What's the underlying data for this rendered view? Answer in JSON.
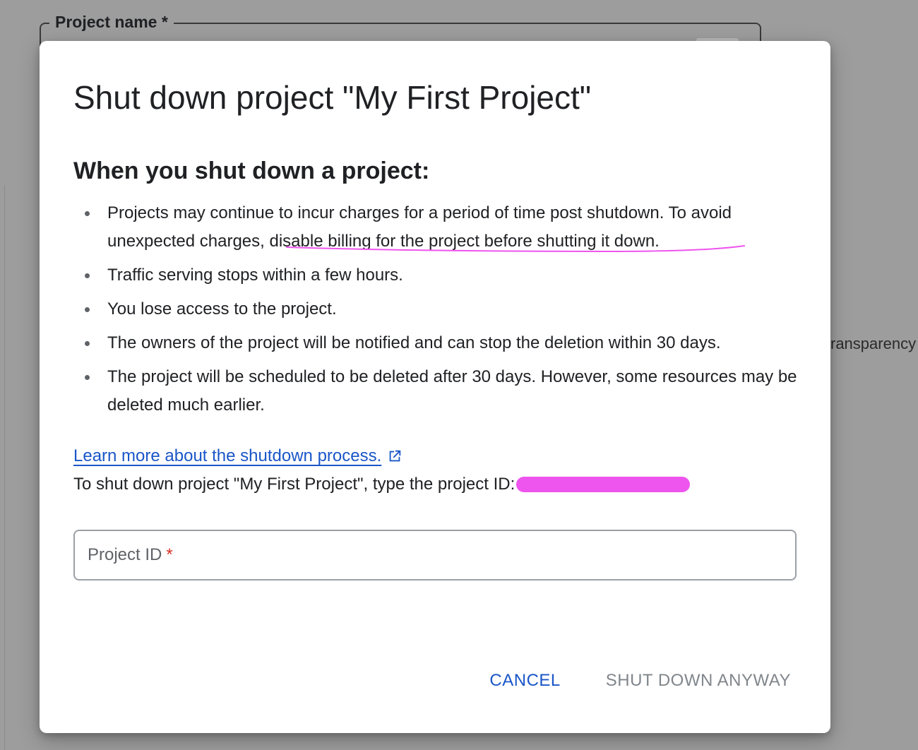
{
  "background": {
    "field_label": "Project name *",
    "side_text": "ransparency"
  },
  "dialog": {
    "title": "Shut down project \"My First Project\"",
    "section_heading": "When you shut down a project:",
    "bullets": [
      {
        "text_before": "Projects may continue to incur charges for a period of time post shutdown. To avoid unexpected charges, ",
        "text_highlighted": "disable billing for the project before shutting it down."
      },
      {
        "text": "Traffic serving stops within a few hours."
      },
      {
        "text": "You lose access to the project."
      },
      {
        "text": "The owners of the project will be notified and can stop the deletion within 30 days."
      },
      {
        "text": "The project will be scheduled to be deleted after 30 days. However, some resources may be deleted much earlier."
      }
    ],
    "learn_more_link": "Learn more about the shutdown process.",
    "instruction": "To shut down project \"My First Project\", type the project ID:",
    "input": {
      "label": "Project ID",
      "required_marker": "*"
    },
    "actions": {
      "cancel_label": "CANCEL",
      "shutdown_label": "SHUT DOWN ANYWAY"
    }
  },
  "colors": {
    "link": "#1a56c8",
    "annotation": "#ee55ee",
    "required": "#d93025",
    "disabled_text": "#80868b"
  }
}
